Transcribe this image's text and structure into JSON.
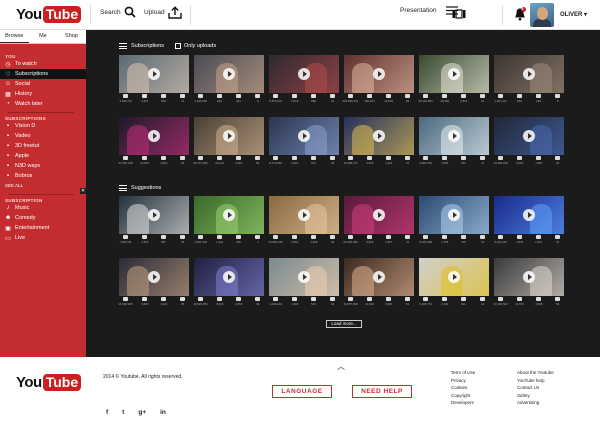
{
  "app": {
    "logo_you": "You",
    "logo_tube": "Tube",
    "brand_color": "#cc1f1f"
  },
  "topbar": {
    "search_label": "Search",
    "upload_label": "Upload",
    "presentation_label": "Presentation",
    "notification_count": "5",
    "user_name": "OLIVER ▾"
  },
  "sidebar": {
    "tabs": [
      {
        "label": "Browse"
      },
      {
        "label": "Me"
      },
      {
        "label": "Shop"
      }
    ],
    "heading_1": "YOU",
    "items": [
      {
        "label": "To watch",
        "icon": "clock-icon"
      },
      {
        "label": "Subscriptions",
        "icon": "heart-icon"
      },
      {
        "label": "Social",
        "icon": "people-icon"
      },
      {
        "label": "History",
        "icon": "history-icon"
      },
      {
        "label": "Watch later",
        "icon": "watch-later-icon"
      }
    ],
    "heading_2": "SUBSCRIPTIONS",
    "subscriptions": [
      {
        "label": "Vision D"
      },
      {
        "label": "Vadeo"
      },
      {
        "label": "3D freetut"
      },
      {
        "label": "Apple"
      },
      {
        "label": "N3D ways"
      },
      {
        "label": "Bobros"
      }
    ],
    "see_all": "SEE ALL",
    "heading_3": "SUBSCRIPTION",
    "categories": [
      {
        "label": "Music",
        "icon": "music-icon"
      },
      {
        "label": "Comedy",
        "icon": "comedy-icon"
      },
      {
        "label": "Entertainment",
        "icon": "entertainment-icon"
      },
      {
        "label": "Live",
        "icon": "live-icon"
      }
    ],
    "close_label": "✕"
  },
  "main": {
    "subscriptions_title": "Subscriptions",
    "only_uploads_label": "Only uploads",
    "suggestions_title": "Suggestions",
    "load_more_label": "Load more..."
  },
  "subscription_videos": [
    {
      "bg": "#5a6a75",
      "accent": "#d8c3b0",
      "stats": [
        "3,345,741",
        "1,337",
        "502",
        "12"
      ]
    },
    {
      "bg": "#4a4a55",
      "accent": "#c9a58a",
      "stats": [
        "2,193,045",
        "824",
        "341",
        "9"
      ]
    },
    {
      "bg": "#2e2a30",
      "accent": "#b34a4a",
      "stats": [
        "5,870,201",
        "2,019",
        "880",
        "22"
      ]
    },
    {
      "bg": "#603030",
      "accent": "#e0b8a0",
      "stats": [
        "402,830,301",
        "150,223",
        "12,004",
        "84"
      ]
    },
    {
      "bg": "#3a4a30",
      "accent": "#e8e8d8",
      "stats": [
        "40,120,884",
        "18,300",
        "2,441",
        "31"
      ]
    },
    {
      "bg": "#3d3530",
      "accent": "#9a8a7a",
      "stats": [
        "1,027,411",
        "604",
        "219",
        "8"
      ]
    },
    {
      "bg": "#1f1a2a",
      "accent": "#c2307a",
      "stats": [
        "37,004,218",
        "12,873",
        "1,902",
        "40"
      ]
    },
    {
      "bg": "#4a4035",
      "accent": "#d0b090",
      "stats": [
        "58,747,003",
        "20,114",
        "3,110",
        "55"
      ]
    },
    {
      "bg": "#2a3550",
      "accent": "#8aa0d0",
      "stats": [
        "8,710,662",
        "3,210",
        "974",
        "18"
      ]
    },
    {
      "bg": "#253060",
      "accent": "#e0c050",
      "stats": [
        "10,288,137",
        "4,420",
        "1,122",
        "27"
      ]
    },
    {
      "bg": "#4a6a80",
      "accent": "#e8eef2",
      "stats": [
        "3,982,554",
        "1,806",
        "512",
        "11"
      ]
    },
    {
      "bg": "#20283a",
      "accent": "#4a6ab0",
      "stats": [
        "14,336,208",
        "6,001",
        "1,887",
        "33"
      ]
    }
  ],
  "suggestion_videos": [
    {
      "bg": "#24323c",
      "accent": "#e0e0e0",
      "stats": [
        "7,405,111",
        "3,330",
        "867",
        "16"
      ]
    },
    {
      "bg": "#3a6a2a",
      "accent": "#9ad070",
      "stats": [
        "2,561,018",
        "1,114",
        "290",
        "7"
      ]
    },
    {
      "bg": "#8a6a40",
      "accent": "#e8c8a0",
      "stats": [
        "12,890,440",
        "5,561",
        "1,408",
        "29"
      ]
    },
    {
      "bg": "#5a1a3a",
      "accent": "#d04080",
      "stats": [
        "22,318,006",
        "9,903",
        "2,557",
        "47"
      ]
    },
    {
      "bg": "#2a4a70",
      "accent": "#b0d0f0",
      "stats": [
        "6,104,338",
        "2,786",
        "715",
        "14"
      ]
    },
    {
      "bg": "#1a2a8a",
      "accent": "#60a0ff",
      "stats": [
        "9,001,257",
        "3,947",
        "1,011",
        "21"
      ]
    },
    {
      "bg": "#2a2a38",
      "accent": "#c0a080",
      "stats": [
        "11,020,935",
        "4,630",
        "1,221",
        "25"
      ]
    },
    {
      "bg": "#202040",
      "accent": "#8080d0",
      "stats": [
        "19,520,354",
        "8,315",
        "2,050",
        "39"
      ]
    },
    {
      "bg": "#7a8a90",
      "accent": "#f0d0b0",
      "stats": [
        "4,446,101",
        "1,902",
        "523",
        "10"
      ]
    },
    {
      "bg": "#3a2a20",
      "accent": "#e0b090",
      "stats": [
        "31,875,009",
        "13,402",
        "3,606",
        "61"
      ]
    },
    {
      "bg": "#d0d0cc",
      "accent": "#e0c020",
      "stats": [
        "5,206,772",
        "2,240",
        "611",
        "12"
      ]
    },
    {
      "bg": "#3a3a3a",
      "accent": "#e0d8d0",
      "stats": [
        "27,100,563",
        "11,870",
        "3,008",
        "52"
      ]
    }
  ],
  "footer": {
    "copyright": "2014 © Youtube. All rights reserved.",
    "language_button": "LANGUAGE",
    "help_button": "NEED HELP",
    "social": [
      "f",
      "t",
      "g+",
      "in"
    ],
    "links_col1": [
      "Term of Use",
      "Privacy",
      "Cookies",
      "Copyright",
      "Developers"
    ],
    "links_col2": [
      "About the Youtube",
      "YouTube help",
      "Contact Us",
      "Safety",
      "Advertising"
    ]
  }
}
